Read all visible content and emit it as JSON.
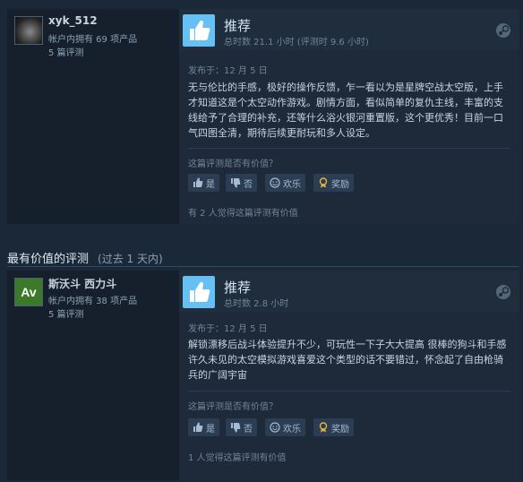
{
  "reviews": [
    {
      "author_name": "xyk_512",
      "products_owned": "帐户内拥有 69 项产品",
      "reviews_count": "5 篇评测",
      "recommendation": "推荐",
      "hours": "总时数 21.1 小时   (评测时 9.6 小时)",
      "posted": "发布于：12 月 5 日",
      "body": "无与伦比的手感，极好的操作反馈，乍一看以为是星牌空战太空版，上手才知道这是个太空动作游戏。剧情方面，看似简单的复仇主线，丰富的支线给予了合理的补充，还等什么浴火银河重置版，这个更优秀！目前一口气四图全清，期待后续更耐玩和多人设定。",
      "helpful_question": "这篇评测是否有价值？",
      "btn_yes": "是",
      "btn_no": "否",
      "btn_funny": "欢乐",
      "btn_award": "奖励",
      "helpful_count": "有 2 人觉得这篇评测有价值"
    },
    {
      "author_name": "斯沃斗 西力斗",
      "avatar_text": "Av",
      "products_owned": "帐户内拥有 38 项产品",
      "reviews_count": "5 篇评测",
      "recommendation": "推荐",
      "hours": "总时数 2.8 小时",
      "posted": "发布于：12 月 5 日",
      "body": "解锁漂移后战斗体验提升不少，可玩性一下子大大提高 很棒的狗斗和手感 许久未见的太空模拟游戏喜爱这个类型的话不要错过，怀念起了自由枪骑兵的广阔宇宙",
      "helpful_question": "这篇评测是否有价值？",
      "btn_yes": "是",
      "btn_no": "否",
      "btn_funny": "欢乐",
      "btn_award": "奖励",
      "helpful_count": "1 人觉得这篇评测有价值"
    }
  ],
  "section": {
    "title": "最有价值的评测",
    "subtitle": "(过去 1 天内)"
  },
  "icons": {
    "thumb": "thumbs-up-icon",
    "steam": "steam-icon",
    "vote_up": "thumbs-up-small-icon",
    "vote_down": "thumbs-down-small-icon",
    "funny": "smiley-icon",
    "award": "award-icon"
  },
  "colors": {
    "background": "#1b2838",
    "accent": "#66c0f4",
    "award": "#e5b43a"
  }
}
